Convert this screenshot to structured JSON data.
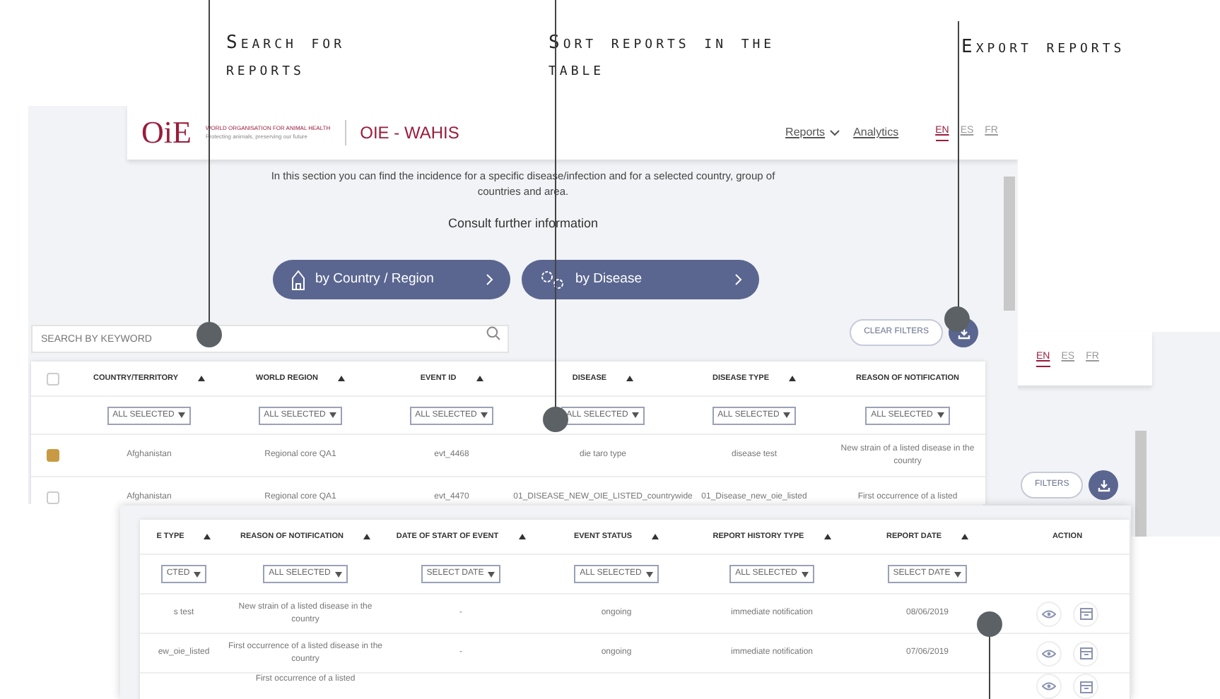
{
  "annotations": [
    {
      "text": "Search for reports"
    },
    {
      "text": "Sort reports in the table"
    },
    {
      "text": "Export reports"
    }
  ],
  "main_window": {
    "logo": {
      "mark": "OiE",
      "org_name": "WORLD ORGANISATION FOR ANIMAL HEALTH",
      "tagline": "Protecting animals, preserving our future"
    },
    "app_title": "OIE - WAHIS",
    "nav": [
      {
        "label": "Reports",
        "dropdown": true
      },
      {
        "label": "Analytics",
        "dropdown": false
      }
    ],
    "languages": [
      {
        "label": "EN",
        "selected": true
      },
      {
        "label": "ES",
        "selected": false
      },
      {
        "label": "FR",
        "selected": false
      }
    ],
    "intro": "In this section you can find the incidence for a specific disease/infection and for a selected country, group of countries and area.",
    "consult": "Consult further information",
    "buttons": [
      {
        "label": "by Country / Region"
      },
      {
        "label": "by Disease"
      }
    ],
    "search": {
      "placeholder": "SEARCH BY KEYWORD"
    },
    "clear_filters": "CLEAR FILTERS",
    "table": {
      "header_checked": false,
      "columns": [
        "COUNTRY/TERRITORY",
        "WORLD REGION",
        "EVENT ID",
        "DISEASE",
        "DISEASE TYPE",
        "REASON OF NOTIFICATION"
      ],
      "filters": [
        "ALL SELECTED",
        "ALL SELECTED",
        "ALL SELECTED",
        "ALL SELECTED",
        "ALL SELECTED",
        "ALL SELECTED"
      ],
      "rows": [
        {
          "checked": true,
          "cells": [
            "Afghanistan",
            "Regional core QA1",
            "evt_4468",
            "die taro type",
            "disease test",
            "New strain of a listed disease in the country"
          ]
        },
        {
          "checked": false,
          "cells": [
            "Afghanistan",
            "Regional core QA1",
            "evt_4470",
            "01_DISEASE_NEW_OIE_LISTED_countrywide",
            "01_Disease_new_oie_listed",
            "First occurrence of a listed"
          ]
        }
      ]
    }
  },
  "side_window": {
    "languages": [
      {
        "label": "EN",
        "selected": true
      },
      {
        "label": "ES",
        "selected": false
      },
      {
        "label": "FR",
        "selected": false
      }
    ],
    "filters_button": "FILTERS"
  },
  "bottom_window": {
    "table": {
      "columns": [
        "E TYPE",
        "REASON OF NOTIFICATION",
        "DATE OF START OF EVENT",
        "EVENT STATUS",
        "REPORT HISTORY TYPE",
        "REPORT DATE",
        "ACTION"
      ],
      "filters": [
        "CTED",
        "ALL SELECTED",
        "SELECT DATE",
        "ALL SELECTED",
        "ALL SELECTED",
        "SELECT DATE"
      ],
      "rows": [
        {
          "cells": [
            "s test",
            "New strain of a listed disease in the country",
            "-",
            "ongoing",
            "immediate notification",
            "08/06/2019"
          ]
        },
        {
          "cells": [
            "ew_oie_listed",
            "First occurrence of a listed disease in the country",
            "-",
            "ongoing",
            "immediate notification",
            "07/06/2019"
          ]
        },
        {
          "cells": [
            null,
            "First occurrence of a listed",
            null,
            null,
            null,
            null
          ]
        }
      ]
    }
  }
}
